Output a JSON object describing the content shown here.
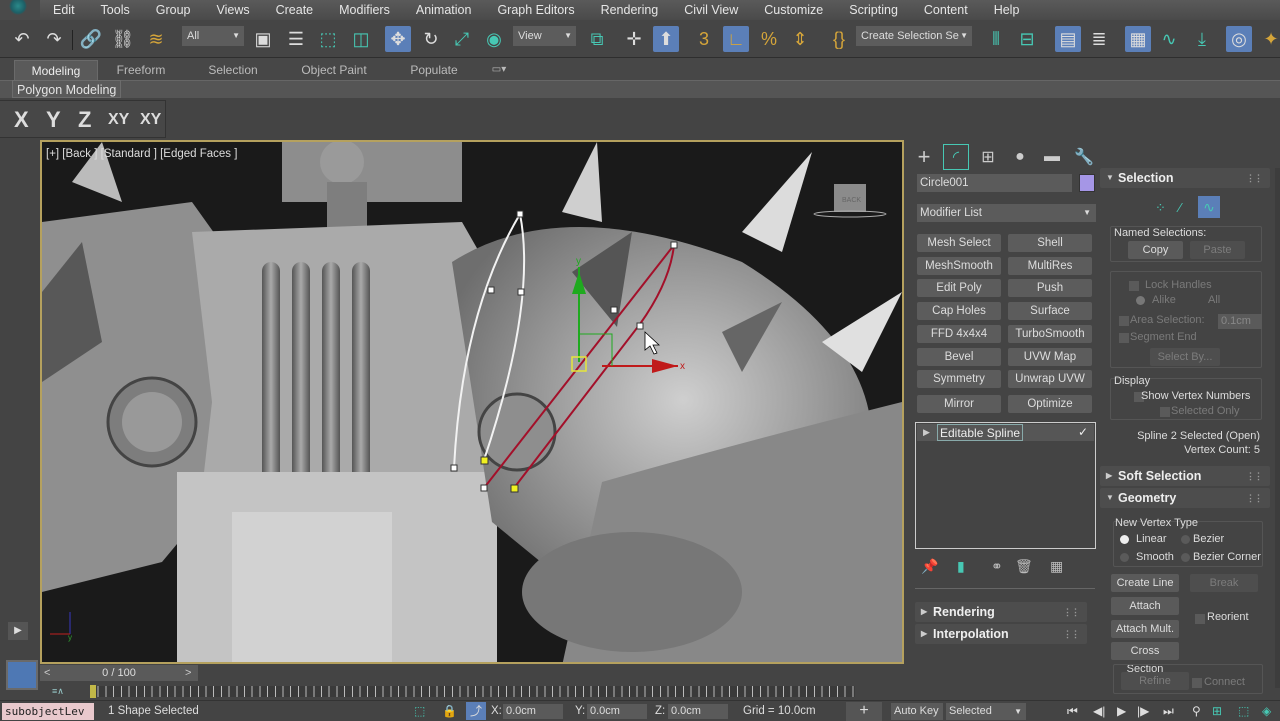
{
  "menu": [
    "Edit",
    "Tools",
    "Group",
    "Views",
    "Create",
    "Modifiers",
    "Animation",
    "Graph Editors",
    "Rendering",
    "Civil View",
    "Customize",
    "Scripting",
    "Content",
    "Help"
  ],
  "toolbar": {
    "selection_filter": "All",
    "reference_coord": "View",
    "named_selection_placeholder": "Create Selection Se",
    "icons": [
      "undo-icon",
      "redo-icon",
      "link-icon",
      "unlink-icon",
      "bind-space-warp-icon",
      "select-object-icon",
      "select-by-name-icon",
      "rect-selection-region-icon",
      "window-crossing-icon",
      "select-move-icon",
      "select-rotate-icon",
      "select-scale-icon",
      "select-place-icon",
      "pivot-center-icon",
      "select-manipulate-icon",
      "keyboard-shortcut-override-icon",
      "snaps-toggle-icon",
      "angle-snap-icon",
      "percent-snap-icon",
      "spinner-snap-icon",
      "edit-named-selection-icon",
      "mirror-icon",
      "align-icon",
      "scene-explorer-icon",
      "layer-explorer-icon",
      "ribbon-toggle-icon",
      "curve-editor-icon",
      "schematic-icon",
      "material-editor-icon"
    ]
  },
  "ribbon": {
    "tabs": [
      "Modeling",
      "Freeform",
      "Selection",
      "Object Paint",
      "Populate"
    ],
    "active_tab": "Modeling",
    "panel_label": "Polygon Modeling"
  },
  "axis_constraints": [
    "X",
    "Y",
    "Z",
    "XY",
    "XY"
  ],
  "viewport": {
    "label": "[+] [Back ] [Standard ] [Edged Faces ]",
    "viewcube_label": "BACK",
    "gizmo_labels": {
      "x": "x",
      "y": "y"
    }
  },
  "command_panel": {
    "tabs": [
      "create-icon",
      "modify-icon",
      "hierarchy-icon",
      "motion-icon",
      "display-icon",
      "utilities-icon"
    ],
    "object_name": "Circle001",
    "object_color": "#a596e6",
    "modifier_list": "Modifier List",
    "modifier_buttons": [
      "Mesh Select",
      "Shell",
      "MeshSmooth",
      "MultiRes",
      "Edit Poly",
      "Push",
      "Cap Holes",
      "Surface",
      "FFD 4x4x4",
      "TurboSmooth",
      "Bevel",
      "UVW Map",
      "Symmetry",
      "Unwrap UVW",
      "Mirror",
      "Optimize"
    ],
    "stack": [
      "Editable Spline"
    ],
    "bottom_rollouts": [
      "Rendering",
      "Interpolation"
    ]
  },
  "selection_rollout": {
    "title": "Selection",
    "named_selections_label": "Named Selections:",
    "copy": "Copy",
    "paste": "Paste",
    "lock_handles": "Lock Handles",
    "alike": "Alike",
    "all": "All",
    "area_selection": "Area Selection:",
    "area_value": "0.1cm",
    "segment_end": "Segment End",
    "select_by": "Select By...",
    "display_label": "Display",
    "show_vertex_numbers": "Show Vertex Numbers",
    "selected_only": "Selected Only",
    "status_line1": "Spline 2 Selected (Open)",
    "status_line2": "Vertex Count: 5"
  },
  "soft_selection": {
    "title": "Soft Selection"
  },
  "geometry": {
    "title": "Geometry",
    "new_vertex_type": "New Vertex Type",
    "linear": "Linear",
    "bezier": "Bezier",
    "smooth": "Smooth",
    "bezier_corner": "Bezier Corner",
    "selected_vertex_type": "Linear",
    "create_line": "Create Line",
    "break": "Break",
    "attach": "Attach",
    "reorient": "Reorient",
    "attach_mult": "Attach Mult.",
    "cross_section": "Cross Section",
    "refine": "Refine",
    "connect": "Connect"
  },
  "timeline": {
    "frame_display": "0 / 100",
    "prev": "<",
    "next": ">"
  },
  "status": {
    "maxscript": "subobjectLev",
    "selection": "1 Shape Selected",
    "x_label": "X:",
    "x": "0.0cm",
    "y_label": "Y:",
    "y": "0.0cm",
    "z_label": "Z:",
    "z": "0.0cm",
    "grid": "Grid = 10.0cm",
    "auto_key": "Auto Key",
    "key_filter": "Selected"
  }
}
